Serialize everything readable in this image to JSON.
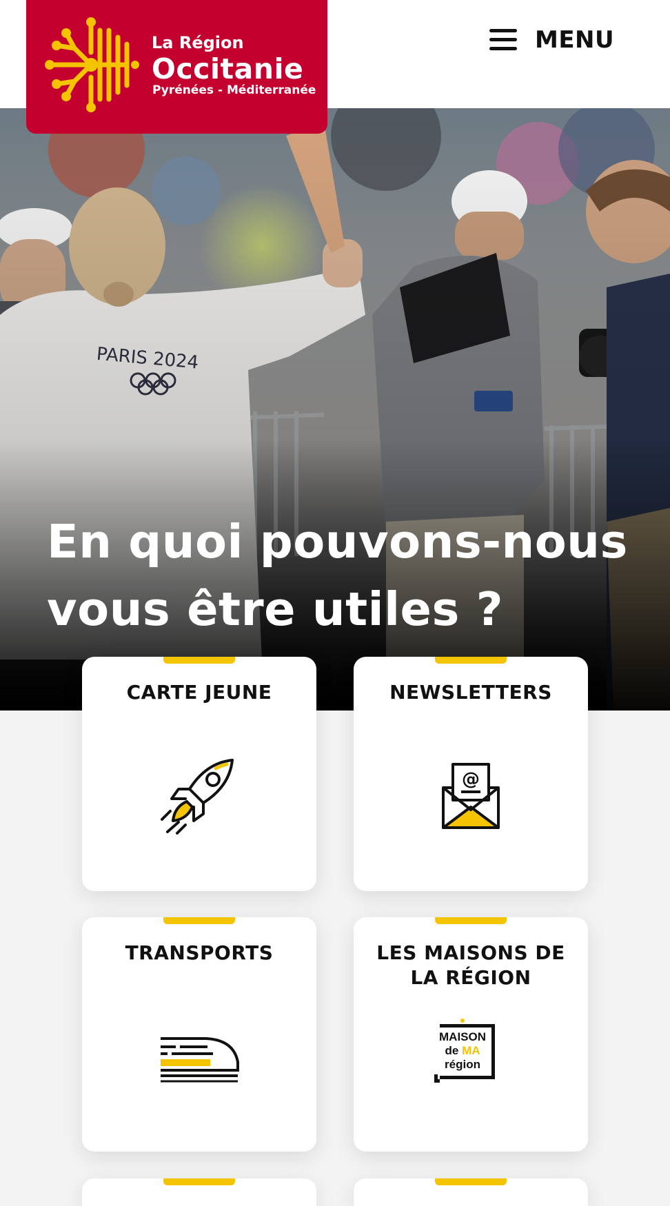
{
  "logo": {
    "line1": "La Région",
    "line2": "Occitanie",
    "line3": "Pyrénées - Méditerranée",
    "bg_color": "#c4002f",
    "cross_color": "#f5c400"
  },
  "menu": {
    "label": "MENU",
    "icon": "hamburger-menu-icon"
  },
  "hero": {
    "title": "En quoi pouvons-nous vous être utiles ?",
    "shirt_text": "PARIS 2024"
  },
  "cards": [
    {
      "title": "CARTE JEUNE",
      "icon": "rocket-icon"
    },
    {
      "title": "NEWSLETTERS",
      "icon": "envelope-at-icon"
    },
    {
      "title": "TRANSPORTS",
      "icon": "train-icon"
    },
    {
      "title": "LES MAISONS DE LA RÉGION",
      "icon": "maison-de-ma-region-icon",
      "icon_text": [
        "MAISON",
        "de",
        "MA",
        "région"
      ]
    }
  ],
  "accent_color": "#f5c400"
}
